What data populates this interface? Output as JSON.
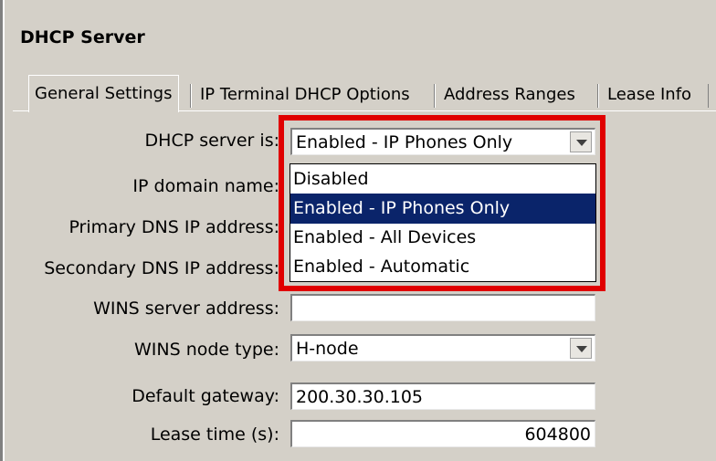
{
  "section": {
    "title": "DHCP Server"
  },
  "tabs": [
    {
      "label": "General Settings"
    },
    {
      "label": "IP Terminal DHCP Options"
    },
    {
      "label": "Address Ranges"
    },
    {
      "label": "Lease Info"
    }
  ],
  "form": {
    "dhcp_server": {
      "label": "DHCP server is:",
      "value": "Enabled - IP Phones Only"
    },
    "ip_domain": {
      "label": "IP domain name:",
      "value": ""
    },
    "primary_dns": {
      "label": "Primary DNS IP address:",
      "value": ""
    },
    "secondary_dns": {
      "label": "Secondary DNS IP address:",
      "value": ""
    },
    "wins_server": {
      "label": "WINS server address:",
      "value": ""
    },
    "wins_node": {
      "label": "WINS node type:",
      "value": "H-node"
    },
    "gateway": {
      "label": "Default gateway:",
      "value": "200.30.30.105"
    },
    "lease_time": {
      "label": "Lease time (s):",
      "value": "604800"
    }
  },
  "dropdown": {
    "options": [
      {
        "label": "Disabled"
      },
      {
        "label": "Enabled - IP Phones Only"
      },
      {
        "label": "Enabled - All Devices"
      },
      {
        "label": "Enabled - Automatic"
      }
    ],
    "selected": "Enabled - IP Phones Only"
  },
  "colors": {
    "highlight": "#e00000",
    "selection": "#0a246a",
    "window_bg": "#d4d0c8"
  }
}
